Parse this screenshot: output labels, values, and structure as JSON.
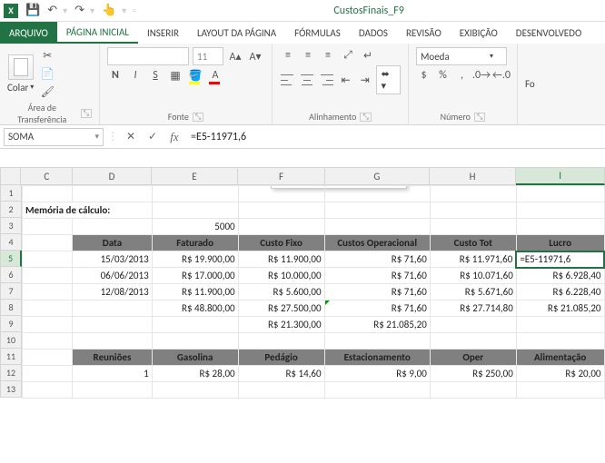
{
  "title": "CustosFinais_F9",
  "qat": {
    "save": "💾",
    "undo": "↶",
    "redo": "↷",
    "touch": "👆"
  },
  "tabs": {
    "file": "ARQUIVO",
    "items": [
      "PÁGINA INICIAL",
      "INSERIR",
      "LAYOUT DA PÁGINA",
      "FÓRMULAS",
      "DADOS",
      "REVISÃO",
      "EXIBIÇÃO",
      "DESENVOLVEDO"
    ]
  },
  "ribbon": {
    "paste": "Colar",
    "clipboard": "Área de Transferência",
    "font_size": "11",
    "font_group": "Fonte",
    "align_group": "Alinhamento",
    "currency": "Moeda",
    "number_group": "Número",
    "format_cells": "Fo"
  },
  "fbar": {
    "name": "SOMA",
    "formula": "=E5-11971,6"
  },
  "cols": [
    "C",
    "D",
    "E",
    "F",
    "G",
    "H",
    "I"
  ],
  "rows": [
    "1",
    "2",
    "3",
    "4",
    "5",
    "6",
    "7",
    "8",
    "9",
    "10",
    "11",
    "12",
    "13"
  ],
  "sheet": {
    "r2": {
      "c": "Memória de cálculo:"
    },
    "r3": {
      "e": "5000"
    },
    "r4": {
      "d": "Data",
      "e": "Faturado",
      "f": "Custo Fixo",
      "g": "Custos Operacional",
      "h": "Custo Tot",
      "i": "Lucro"
    },
    "r5": {
      "d": "15/03/2013",
      "e": "R$ 19.900,00",
      "f": "R$ 11.900,00",
      "g": "R$ 71,60",
      "h": "R$ 11.971,60",
      "i": "=E5-11971,6"
    },
    "r6": {
      "d": "06/06/2013",
      "e": "R$ 17.000,00",
      "f": "R$ 10.000,00",
      "g": "R$ 71,60",
      "h": "R$ 10.071,60",
      "i": "R$ 6.928,40"
    },
    "r7": {
      "d": "12/08/2013",
      "e": "R$ 11.900,00",
      "f": "R$ 5.600,00",
      "g": "R$ 71,60",
      "h": "R$ 5.671,60",
      "i": "R$ 6.228,40"
    },
    "r8": {
      "e": "R$ 48.800,00",
      "f": "R$ 27.500,00",
      "g": "R$ 71,60",
      "h": "R$ 27.714,80",
      "i": "R$ 21.085,20"
    },
    "r9": {
      "f": "R$ 21.300,00",
      "g": "R$ 21.085,20"
    },
    "r11": {
      "d": "Reuniões",
      "e": "Gasolina",
      "f": "Pedágio",
      "g": "Estacionamento",
      "h": "Oper",
      "i": "Alimentação"
    },
    "r12": {
      "d": "1",
      "e": "R$ 28,00",
      "f": "R$ 14,60",
      "g": "R$ 9,00",
      "h": "R$ 250,00",
      "i": "R$ 20,00"
    }
  }
}
